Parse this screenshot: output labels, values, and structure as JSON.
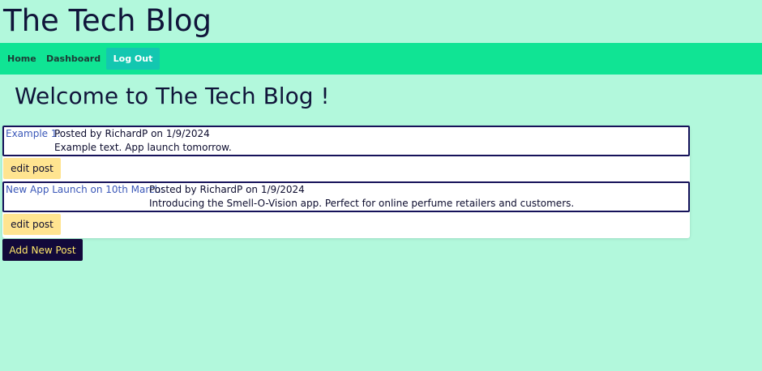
{
  "site": {
    "title": "The Tech Blog"
  },
  "nav": {
    "home_label": "Home",
    "dashboard_label": "Dashboard",
    "logout_label": "Log Out"
  },
  "main": {
    "welcome": "Welcome to The Tech Blog !"
  },
  "posts": [
    {
      "title": "Example 1:",
      "meta": "Posted by RichardP on 1/9/2024",
      "body": "Example text. App launch tomorrow.",
      "edit_label": "edit post"
    },
    {
      "title": "New App Launch on 10th March:",
      "meta": "Posted by RichardP on 1/9/2024",
      "body": "Introducing the Smell-O-Vision app. Perfect for online perfume retailers and customers.",
      "edit_label": "edit post"
    }
  ],
  "actions": {
    "add_post_label": "Add New Post"
  },
  "colors": {
    "page_bg": "#b2f8dc",
    "navbar_bg": "#10e494",
    "logout_bg": "#13c7b0",
    "edit_bg": "#ffe490",
    "add_bg": "#12093a",
    "add_text": "#ffe86a",
    "post_border": "#16125a",
    "link_blue": "#3a57b8"
  }
}
